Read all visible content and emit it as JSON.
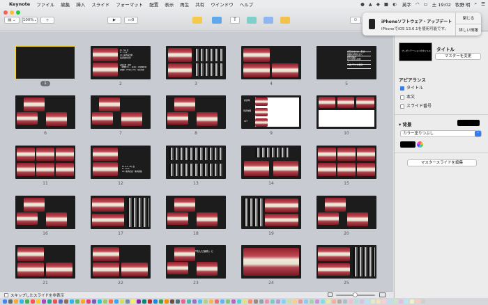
{
  "menubar": {
    "apple": "",
    "app": "Keynote",
    "items": [
      "ファイル",
      "編集",
      "挿入",
      "スライド",
      "フォーマット",
      "配置",
      "表示",
      "再生",
      "共有",
      "ウインドウ",
      "ヘルプ"
    ],
    "lang": "英字",
    "time": "土 19:02",
    "user": "牧野 明"
  },
  "toolbar": {
    "zoom": "100%",
    "play_hint": "0"
  },
  "notification": {
    "title": "iPhoneソフトウェア・アップデート",
    "body": "iPhoneでiOS 13.6.1を使用可能です。",
    "close": "閉じる",
    "details": "詳しい情報"
  },
  "slides": [
    {
      "n": "1",
      "kind": "black"
    },
    {
      "n": "2",
      "kind": "teeth-text"
    },
    {
      "n": "3",
      "kind": "teeth-xray"
    },
    {
      "n": "4",
      "kind": "teeth-double"
    },
    {
      "n": "5",
      "kind": "text-slide"
    },
    {
      "n": "6",
      "kind": "teeth-three"
    },
    {
      "n": "7",
      "kind": "teeth-three"
    },
    {
      "n": "8",
      "kind": "teeth-three"
    },
    {
      "n": "9",
      "kind": "perio-chart"
    },
    {
      "n": "10",
      "kind": "teeth-chart"
    },
    {
      "n": "11",
      "kind": "teeth-grid"
    },
    {
      "n": "12",
      "kind": "teeth-text"
    },
    {
      "n": "13",
      "kind": "xray-full"
    },
    {
      "n": "14",
      "kind": "xray-arch"
    },
    {
      "n": "15",
      "kind": "teeth-grid"
    },
    {
      "n": "16",
      "kind": "teeth-three"
    },
    {
      "n": "17",
      "kind": "teeth-xray-side"
    },
    {
      "n": "18",
      "kind": "teeth-three"
    },
    {
      "n": "19",
      "kind": "xray-teeth"
    },
    {
      "n": "20",
      "kind": "teeth-three"
    },
    {
      "n": "21",
      "kind": "teeth-double"
    },
    {
      "n": "22",
      "kind": "teeth-double"
    },
    {
      "n": "23",
      "kind": "teeth-three"
    },
    {
      "n": "24",
      "kind": "teeth-wide"
    },
    {
      "n": "25",
      "kind": "teeth-xray-side"
    }
  ],
  "slide_text": {
    "s2": [
      "Pt. 70y 女",
      "Fr. 7.4.1",
      "CC. 歯周病治療",
      "再評価を希望",
      "▶既往歴・嗜好",
      "　喫煙歴なし・高血圧・軽度糖尿病",
      "▶喫煙：20本/日 20y・現在禁煙"
    ],
    "s5": [
      "歯石の付き方・形状",
      "根面の状態を診て",
      "PMTC時の",
      "咬合状態も参照",
      "↓",
      "1.歯ブラシの指導"
    ],
    "s9": [
      "初診時",
      "再評価時",
      "SPT"
    ],
    "s12": [
      "Pt. K.A. 70y 女",
      "Fr. 7.6.3",
      "CC. 歯肉出血・歯肉退縮"
    ],
    "s23": [
      "「咬んだ痕跡」に"
    ]
  },
  "bottombar": {
    "skip_label": "スキップしたスライドを非表示"
  },
  "inspector": {
    "title_label": "タイトル",
    "master_change": "マスターを変更",
    "appearance": "アピアランス",
    "opt_title": "タイトル",
    "opt_body": "本文",
    "opt_slide_number": "スライド番号",
    "background": "背景",
    "fill_type": "カラー塗りつぶし",
    "edit_master": "マスタースライドを編集",
    "thumb_text": "プレゼンテーションのタイトル"
  },
  "colors": {
    "accent": "#2f7cf6",
    "selected_border": "#f5d417"
  }
}
